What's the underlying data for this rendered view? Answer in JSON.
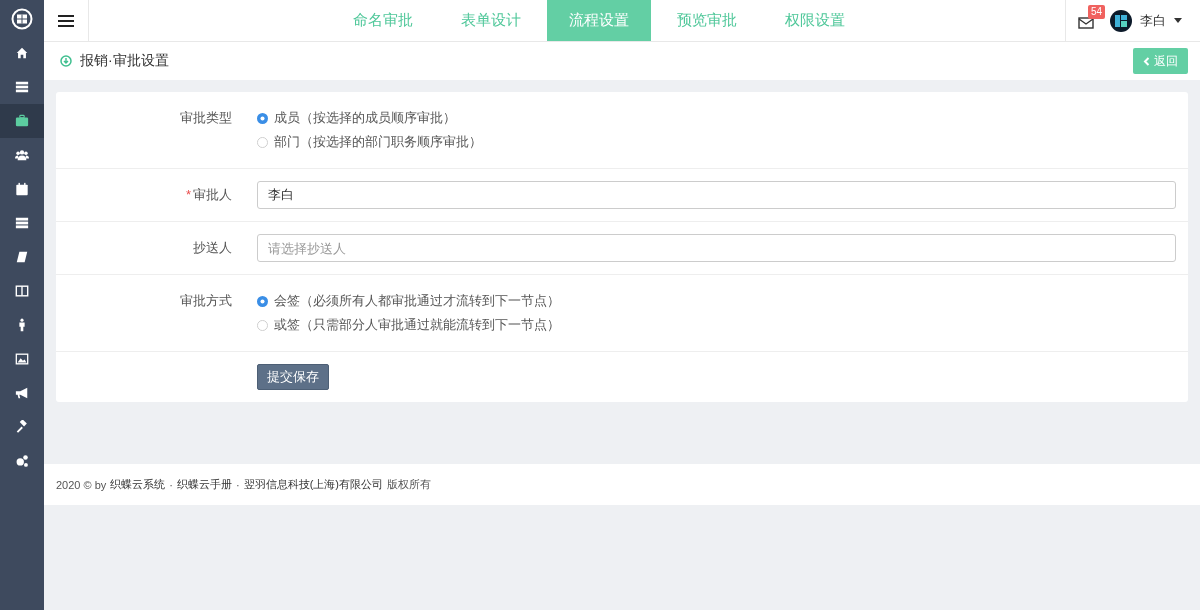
{
  "sidebar": {
    "items": [
      {
        "selected": false
      },
      {
        "selected": false
      },
      {
        "selected": true
      },
      {
        "selected": false
      },
      {
        "selected": false
      },
      {
        "selected": false
      },
      {
        "selected": false
      },
      {
        "selected": false
      },
      {
        "selected": false
      },
      {
        "selected": false
      },
      {
        "selected": false
      },
      {
        "selected": false
      },
      {
        "selected": false
      }
    ]
  },
  "tabs": [
    {
      "label": "命名审批",
      "selected": false
    },
    {
      "label": "表单设计",
      "selected": false
    },
    {
      "label": "流程设置",
      "selected": true
    },
    {
      "label": "预览审批",
      "selected": false
    },
    {
      "label": "权限设置",
      "selected": false
    }
  ],
  "user": {
    "mail_badge": "54",
    "name": "李白"
  },
  "page_header": {
    "title": "报销·审批设置",
    "back_button": "返回"
  },
  "form": {
    "rows": [
      {
        "kind": "radio",
        "label": "审批类型",
        "options": [
          {
            "label": "成员（按选择的成员顺序审批）",
            "selected": true
          },
          {
            "label": "部门（按选择的部门职务顺序审批）",
            "selected": false
          }
        ]
      },
      {
        "kind": "input",
        "label": "审批人",
        "required_mark": "*",
        "value": "李白"
      },
      {
        "kind": "input",
        "label": "抄送人",
        "placeholder": "请选择抄送人"
      },
      {
        "kind": "radio",
        "label": "审批方式",
        "options": [
          {
            "label": "会签（必须所有人都审批通过才流转到下一节点）",
            "selected": true
          },
          {
            "label": "或签（只需部分人审批通过就能流转到下一节点）",
            "selected": false
          }
        ]
      }
    ],
    "submit_button": "提交保存"
  },
  "footer": [
    {
      "kind": "text",
      "text": "2020 © by"
    },
    {
      "kind": "link",
      "text": "织蝶云系统"
    },
    {
      "kind": "text",
      "text": "·"
    },
    {
      "kind": "link",
      "text": "织蝶云手册"
    },
    {
      "kind": "text",
      "text": "·"
    },
    {
      "kind": "link",
      "text": "翌羽信息科技(上海)有限公司"
    },
    {
      "kind": "text",
      "text": "版权所有"
    }
  ]
}
